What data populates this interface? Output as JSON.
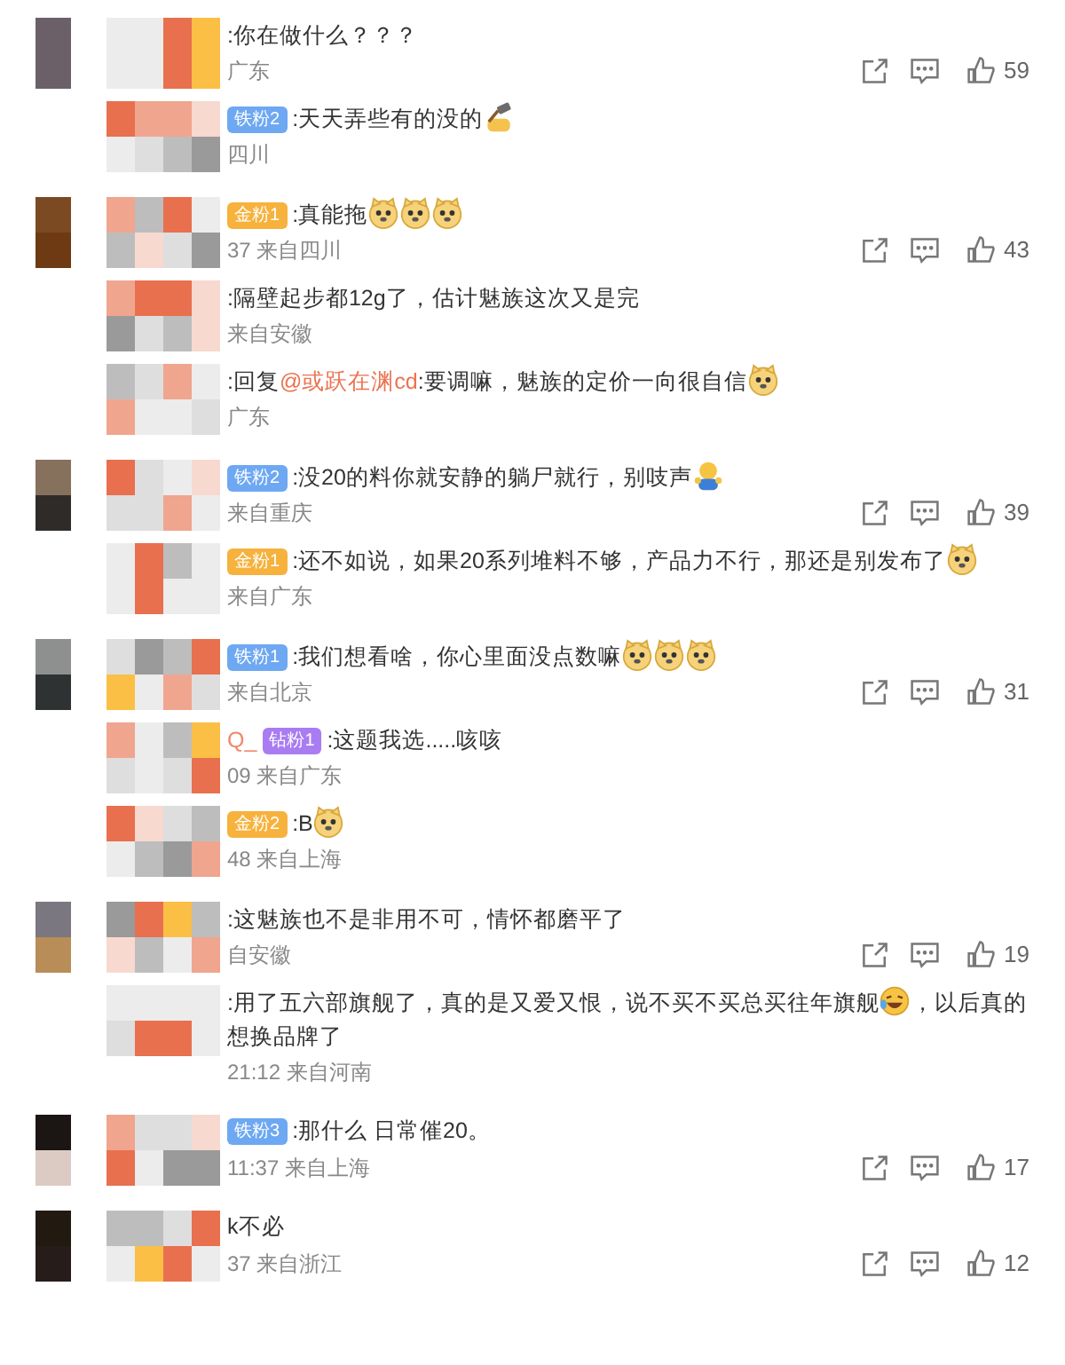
{
  "comments": [
    {
      "content": [
        {
          "kind": "text",
          "text": ":你在做什么？？？"
        }
      ],
      "meta": "广东",
      "likes": "59",
      "replies": [
        {
          "badge": {
            "kind": "iron",
            "label": "铁粉2"
          },
          "content": [
            {
              "kind": "text",
              "text": ":天天弄些有的没的"
            },
            {
              "kind": "hammer"
            }
          ],
          "meta": "四川"
        }
      ]
    },
    {
      "badge": {
        "kind": "gold",
        "label": "金粉1"
      },
      "content": [
        {
          "kind": "text",
          "text": ":真能拖"
        },
        {
          "kind": "doge"
        },
        {
          "kind": "doge"
        },
        {
          "kind": "doge"
        }
      ],
      "meta": "37 来自四川",
      "likes": "43",
      "replies": [
        {
          "content": [
            {
              "kind": "text",
              "text": ":隔壁起步都12g了，估计魅族这次又是完"
            }
          ],
          "meta": "来自安徽"
        },
        {
          "content": [
            {
              "kind": "text",
              "text": ":回复"
            },
            {
              "kind": "mention",
              "text": "@或跃在渊cd"
            },
            {
              "kind": "text",
              "text": ":要调嘛，魅族的定价一向很自信"
            },
            {
              "kind": "doge"
            }
          ],
          "meta": "广东"
        }
      ]
    },
    {
      "badge": {
        "kind": "iron",
        "label": "铁粉2"
      },
      "content": [
        {
          "kind": "text",
          "text": ":没20的料你就安静的躺尸就行，别吱声"
        },
        {
          "kind": "hug"
        }
      ],
      "meta": "来自重庆",
      "likes": "39",
      "replies": [
        {
          "badge": {
            "kind": "gold",
            "label": "金粉1"
          },
          "content": [
            {
              "kind": "text",
              "text": ":还不如说，如果20系列堆料不够，产品力不行，那还是别发布了"
            },
            {
              "kind": "doge"
            }
          ],
          "meta": "来自广东"
        }
      ]
    },
    {
      "badge": {
        "kind": "iron",
        "label": "铁粉1"
      },
      "content": [
        {
          "kind": "text",
          "text": ":我们想看啥，你心里面没点数嘛"
        },
        {
          "kind": "doge"
        },
        {
          "kind": "doge"
        },
        {
          "kind": "doge"
        }
      ],
      "meta": "来自北京",
      "likes": "31",
      "replies": [
        {
          "name_fragment": "Q_",
          "badge": {
            "kind": "diamond",
            "label": "钻粉1"
          },
          "content": [
            {
              "kind": "text",
              "text": ":这题我选.....咳咳"
            }
          ],
          "meta": "09 来自广东"
        },
        {
          "badge": {
            "kind": "gold",
            "label": "金粉2"
          },
          "content": [
            {
              "kind": "text",
              "text": ":B"
            },
            {
              "kind": "doge"
            }
          ],
          "meta": "48 来自上海"
        }
      ]
    },
    {
      "content": [
        {
          "kind": "text",
          "text": ":这魅族也不是非用不可，情怀都磨平了"
        }
      ],
      "meta": "自安徽",
      "likes": "19",
      "replies": [
        {
          "content": [
            {
              "kind": "text",
              "text": ":用了五六部旗舰了，真的是又爱又恨，说不买不买总买往年旗舰"
            },
            {
              "kind": "laugh-cry"
            },
            {
              "kind": "text",
              "text": "，以后真的想换品牌了"
            }
          ],
          "meta": "21:12 来自河南"
        }
      ]
    },
    {
      "badge": {
        "kind": "iron",
        "label": "铁粉3"
      },
      "content": [
        {
          "kind": "text",
          "text": ":那什么 日常催20。"
        }
      ],
      "meta": "11:37 来自上海",
      "likes": "17"
    },
    {
      "content": [
        {
          "kind": "text",
          "text": "k不必"
        }
      ],
      "meta": "37 来自浙江",
      "likes": "12"
    }
  ]
}
